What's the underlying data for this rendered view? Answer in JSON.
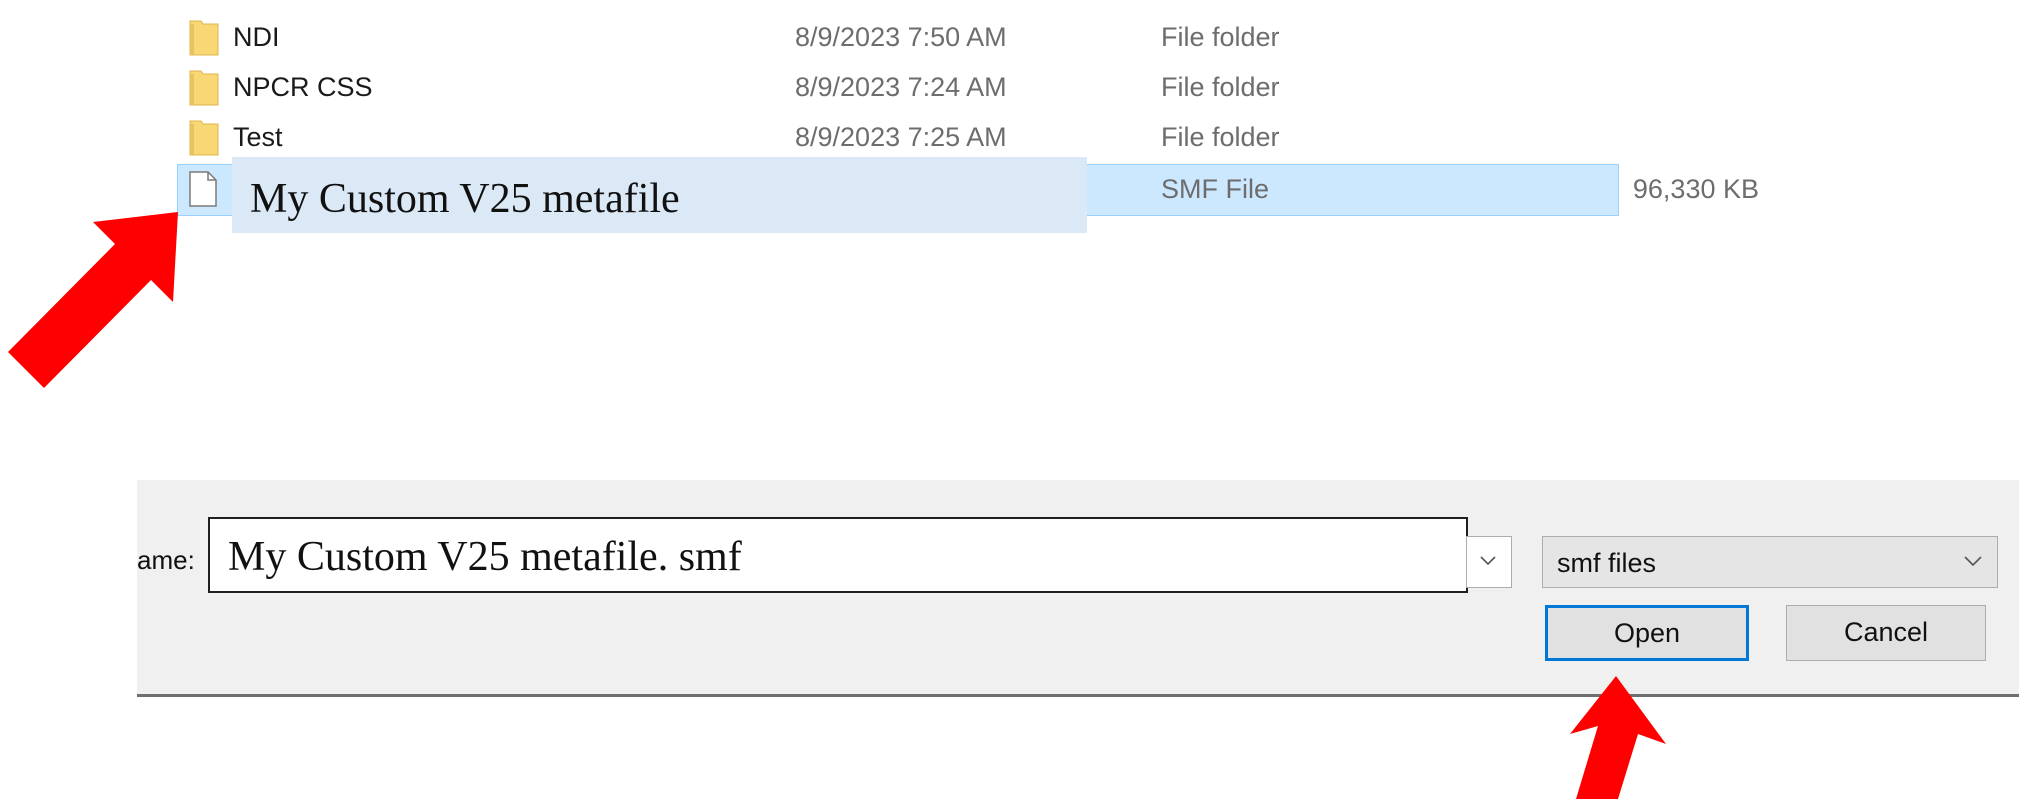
{
  "file_list": {
    "rows": [
      {
        "name": "NDI",
        "date": "8/9/2023 7:50 AM",
        "type": "File folder",
        "size": ""
      },
      {
        "name": "NPCR CSS",
        "date": "8/9/2023 7:24 AM",
        "type": "File folder",
        "size": ""
      },
      {
        "name": "Test",
        "date": "8/9/2023 7:25 AM",
        "type": "File folder",
        "size": ""
      }
    ],
    "selected": {
      "name": "My Custom V25 metafile",
      "type": "SMF File",
      "size": "96,330 KB"
    }
  },
  "bottom": {
    "filename_label": "ame:",
    "filename_value": "My Custom V25 metafile. smf",
    "filter_value": "smf files",
    "open_label": "Open",
    "cancel_label": "Cancel"
  },
  "colors": {
    "selection_bg": "#cce8ff",
    "selection_border": "#99d1ff",
    "arrow": "#ff0000",
    "open_border": "#0078d7",
    "folder": "#f8d775"
  },
  "icons": [
    "folder-icon",
    "file-icon",
    "chevron-down-icon",
    "red-arrow-icon"
  ]
}
